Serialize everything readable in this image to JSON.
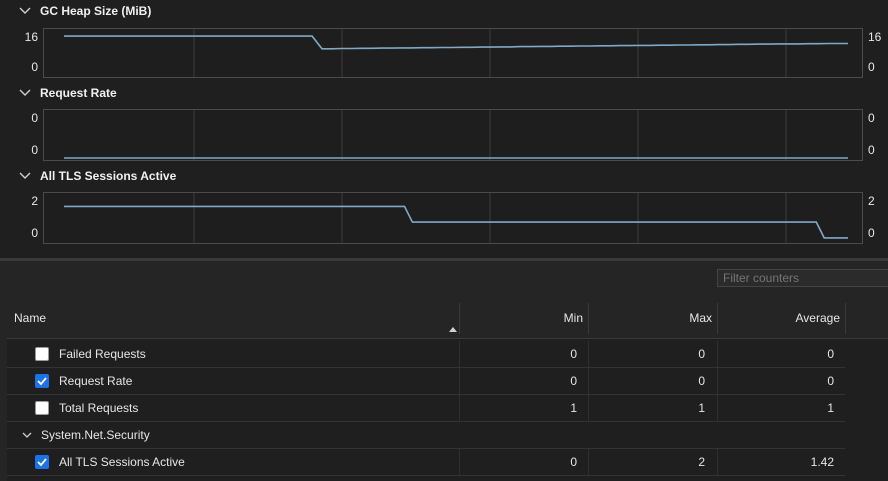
{
  "charts": [
    {
      "title": "GC Heap Size (MiB)",
      "y_max_label": "16",
      "y_min_label": "0",
      "chart_data": {
        "type": "line",
        "title": "GC Heap Size (MiB)",
        "ylim": [
          0,
          20
        ],
        "values": [
          18.5,
          18.5,
          18.5,
          18.5,
          18.5,
          18.5,
          18.5,
          18.5,
          18.5,
          18.5,
          18.5,
          18.5,
          18.5,
          18.5,
          18.5,
          18.5,
          18.5,
          18.5,
          18.5,
          18.5,
          18.5,
          18.5,
          18.5,
          18.5,
          18.5,
          18.5,
          12.5,
          12.5,
          12.6,
          12.6,
          12.7,
          12.7,
          12.8,
          12.8,
          12.9,
          12.9,
          13.0,
          13.0,
          13.1,
          13.1,
          13.2,
          13.2,
          13.3,
          13.3,
          13.4,
          13.4,
          13.5,
          13.5,
          13.6,
          13.6,
          13.7,
          13.7,
          13.8,
          13.8,
          13.9,
          13.9,
          14.0,
          14.0,
          14.1,
          14.1,
          14.2,
          14.2,
          14.3,
          14.3,
          14.4,
          14.4,
          14.5,
          14.5,
          14.6,
          14.6,
          14.7,
          14.7,
          14.8,
          14.8,
          14.8,
          14.9,
          14.9,
          15.0,
          15.0,
          15.0
        ]
      }
    },
    {
      "title": "Request Rate",
      "y_max_label": "0",
      "y_min_label": "0",
      "chart_data": {
        "type": "line",
        "title": "Request Rate",
        "ylim": [
          0,
          1
        ],
        "values": [
          0,
          0,
          0,
          0,
          0,
          0,
          0,
          0,
          0,
          0
        ]
      }
    },
    {
      "title": "All TLS Sessions Active",
      "y_max_label": "2",
      "y_min_label": "0",
      "chart_data": {
        "type": "line",
        "title": "All TLS Sessions Active",
        "ylim": [
          -0.2,
          2.6
        ],
        "values": [
          2,
          2,
          2,
          2,
          2,
          2,
          2,
          2,
          2,
          2,
          2,
          2,
          2,
          2,
          2,
          2,
          2,
          2,
          2,
          2,
          2,
          2,
          2,
          2,
          2,
          2,
          2,
          2,
          2,
          2,
          2,
          2,
          2,
          2,
          2,
          2,
          2,
          2,
          2,
          2,
          2,
          2,
          2,
          2,
          1,
          1,
          1,
          1,
          1,
          1,
          1,
          1,
          1,
          1,
          1,
          1,
          1,
          1,
          1,
          1,
          1,
          1,
          1,
          1,
          1,
          1,
          1,
          1,
          1,
          1,
          1,
          1,
          1,
          1,
          1,
          1,
          1,
          1,
          1,
          1,
          1,
          1,
          1,
          1,
          1,
          1,
          1,
          1,
          1,
          1,
          1,
          1,
          1,
          1,
          1,
          1,
          0,
          0,
          0,
          0
        ]
      }
    }
  ],
  "filter": {
    "placeholder": "Filter counters"
  },
  "table": {
    "columns": {
      "name": "Name",
      "min": "Min",
      "max": "Max",
      "average": "Average"
    },
    "rows": [
      {
        "kind": "item",
        "name": "Failed Requests",
        "checked": false,
        "min": "0",
        "max": "0",
        "average": "0"
      },
      {
        "kind": "item",
        "name": "Request Rate",
        "checked": true,
        "min": "0",
        "max": "0",
        "average": "0"
      },
      {
        "kind": "item",
        "name": "Total Requests",
        "checked": false,
        "min": "1",
        "max": "1",
        "average": "1"
      },
      {
        "kind": "group",
        "name": "System.Net.Security"
      },
      {
        "kind": "item",
        "name": "All TLS Sessions Active",
        "checked": true,
        "min": "0",
        "max": "2",
        "average": "1.42"
      }
    ]
  },
  "colors": {
    "line": "#7fa9c6",
    "grid": "#3c3c3c",
    "checkbox_on": "#1a73e8"
  }
}
